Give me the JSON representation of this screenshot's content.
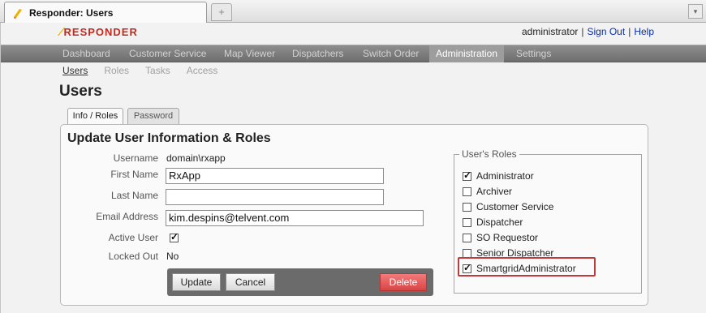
{
  "browser": {
    "tab_title": "Responder: Users",
    "newtab_symbol": "+",
    "menu_symbol": "▾"
  },
  "header": {
    "logo_mark": "⁄",
    "brand": "RESPONDER",
    "user": "administrator",
    "separator": "|",
    "sign_out": "Sign Out",
    "help": "Help"
  },
  "main_nav": [
    "Dashboard",
    "Customer Service",
    "Map Viewer",
    "Dispatchers",
    "Switch Order",
    "Administration",
    "Settings"
  ],
  "sub_nav": [
    "Users",
    "Roles",
    "Tasks",
    "Access"
  ],
  "page_title": "Users",
  "form_tabs": [
    "Info / Roles",
    "Password"
  ],
  "panel": {
    "title": "Update User Information & Roles",
    "labels": {
      "username": "Username",
      "first_name": "First Name",
      "last_name": "Last Name",
      "email": "Email Address",
      "active_user": "Active User",
      "locked_out": "Locked Out"
    },
    "values": {
      "username": "domain\\rxapp",
      "first_name": "RxApp",
      "last_name": "",
      "email": "kim.despins@telvent.com",
      "active_user": true,
      "locked_out": "No"
    },
    "buttons": {
      "update": "Update",
      "cancel": "Cancel",
      "delete": "Delete"
    },
    "roles_legend": "User's Roles",
    "roles": [
      {
        "label": "Administrator",
        "checked": true
      },
      {
        "label": "Archiver",
        "checked": false
      },
      {
        "label": "Customer Service",
        "checked": false
      },
      {
        "label": "Dispatcher",
        "checked": false
      },
      {
        "label": "SO Requestor",
        "checked": false
      },
      {
        "label": "Senior Dispatcher",
        "checked": false
      },
      {
        "label": "SmartgridAdministrator",
        "checked": true
      }
    ]
  },
  "colors": {
    "brand_red": "#c32a1f",
    "link_blue": "#0b2f9e",
    "highlight": "#c0393b"
  }
}
